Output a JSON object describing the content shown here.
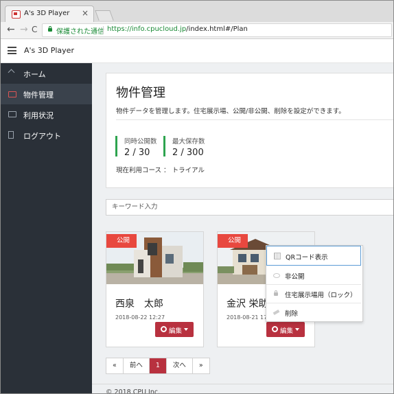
{
  "browser": {
    "tab_title": "A's 3D Player",
    "tab_close": "×",
    "back": "←",
    "forward": "→",
    "reload": "C",
    "secure_label": "保護された通信",
    "url_scheme_host": "https://info.cpucloud.jp",
    "url_path": "/index.html#/Plan"
  },
  "app": {
    "name": "A's 3D Player"
  },
  "sidebar": {
    "items": [
      {
        "label": "ホーム",
        "icon": "home-icon"
      },
      {
        "label": "物件管理",
        "icon": "folder-icon",
        "active": true
      },
      {
        "label": "利用状況",
        "icon": "chat-icon"
      },
      {
        "label": "ログアウト",
        "icon": "logout-icon"
      }
    ]
  },
  "main": {
    "title": "物件管理",
    "description": "物件データを管理します。住宅展示場、公開/非公開、削除を設定ができます。",
    "stats": [
      {
        "label": "同時公開数",
        "value": "2 / 30"
      },
      {
        "label": "最大保存数",
        "value": "2 / 300"
      }
    ],
    "plan_text": "現在利用コース ： トライアル",
    "search_placeholder": "キーワード入力"
  },
  "properties": [
    {
      "badge": "公開",
      "name": "西泉　太郎",
      "date": "2018-08-22 12:27",
      "edit_label": "編集"
    },
    {
      "badge": "公開",
      "name": "金沢 栄助",
      "date": "2018-08-21 17:15",
      "edit_label": "編集"
    }
  ],
  "dropdown": {
    "items": [
      {
        "label": "QRコード表示",
        "icon": "qr-icon"
      },
      {
        "label": "非公開",
        "icon": "eye-icon"
      },
      {
        "label": "住宅展示場用（ロック）",
        "icon": "lock-icon"
      },
      {
        "label": "削除",
        "icon": "eraser-icon"
      }
    ]
  },
  "pagination": {
    "first": "«",
    "prev": "前へ",
    "current": "1",
    "next": "次へ",
    "last": "»"
  },
  "footer": {
    "text": "© 2018 CPU Inc."
  },
  "colors": {
    "sidebar_bg": "#2a3038",
    "accent_red": "#b8313f",
    "badge_red": "#e8483f",
    "stat_green": "#2ea44f"
  }
}
